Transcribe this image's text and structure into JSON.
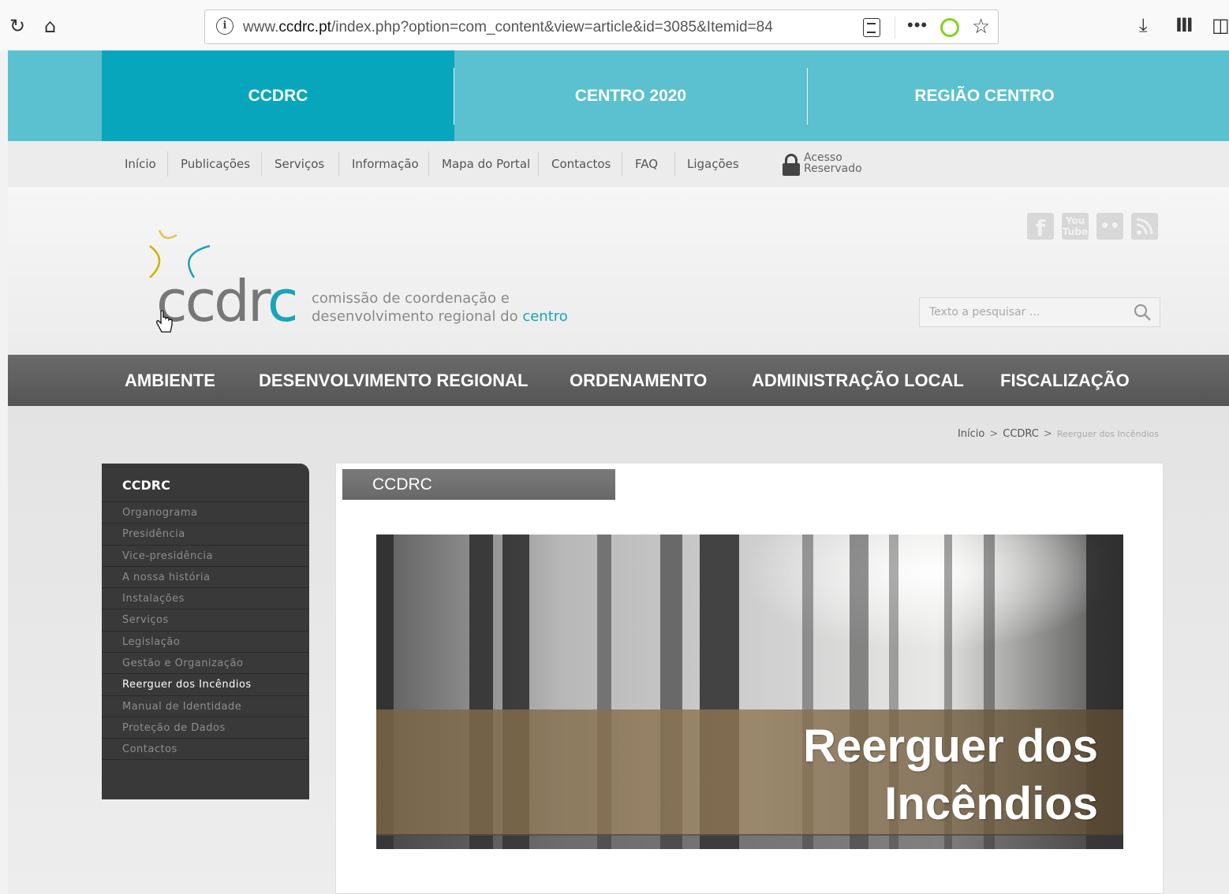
{
  "browser": {
    "url_prefix": "www.",
    "url_host": "ccdrc.pt",
    "url_path": "/index.php?option=com_content&view=article&id=3085&Itemid=84"
  },
  "top_tabs": [
    {
      "label": "CCDRC",
      "active": true
    },
    {
      "label": "CENTRO 2020",
      "active": false
    },
    {
      "label": "REGIÃO CENTRO",
      "active": false
    }
  ],
  "sub_nav": [
    "Início",
    "Publicações",
    "Serviços",
    "Informação",
    "Mapa do Portal",
    "Contactos",
    "FAQ",
    "Ligações"
  ],
  "acesso_reservado": {
    "line1": "Acesso",
    "line2": "Reservado"
  },
  "logo": {
    "word": "ccdr",
    "word_last": "c",
    "tagline_line1": "comissão de coordenação e",
    "tagline_line2": "desenvolvimento regional do ",
    "tagline_accent": "centro"
  },
  "social_icons": [
    "facebook-icon",
    "youtube-icon",
    "flickr-icon",
    "rss-icon"
  ],
  "social_youtube_text": {
    "top": "You",
    "bottom": "Tube"
  },
  "search": {
    "placeholder": "Texto a pesquisar ..."
  },
  "main_nav": [
    "AMBIENTE",
    "DESENVOLVIMENTO REGIONAL",
    "ORDENAMENTO",
    "ADMINISTRAÇÃO LOCAL",
    "FISCALIZAÇÃO"
  ],
  "breadcrumb": {
    "items": [
      "Início",
      "CCDRC"
    ],
    "current": "Reerguer dos Incêndios",
    "separator": ">"
  },
  "side_menu": {
    "title": "CCDRC",
    "items": [
      {
        "label": "Organograma",
        "active": false
      },
      {
        "label": "Presidência",
        "active": false
      },
      {
        "label": "Vice-presidência",
        "active": false
      },
      {
        "label": "A nossa história",
        "active": false
      },
      {
        "label": "Instalações",
        "active": false
      },
      {
        "label": "Serviços",
        "active": false
      },
      {
        "label": "Legislação",
        "active": false
      },
      {
        "label": "Gestão e Organização",
        "active": false
      },
      {
        "label": "Reerguer dos Incêndios",
        "active": true
      },
      {
        "label": "Manual de Identidade",
        "active": false
      },
      {
        "label": "Proteção de Dados",
        "active": false
      },
      {
        "label": "Contactos",
        "active": false
      }
    ]
  },
  "article": {
    "section_tab": "CCDRC",
    "banner_title_line1": "Reerguer dos",
    "banner_title_line2": "Incêndios"
  },
  "colors": {
    "teal_active": "#08a6bd",
    "teal_band": "#5bc0d0",
    "dark_nav": "#5e5e5e",
    "side_menu": "#393939",
    "brand_accent": "#1ba3b8"
  }
}
